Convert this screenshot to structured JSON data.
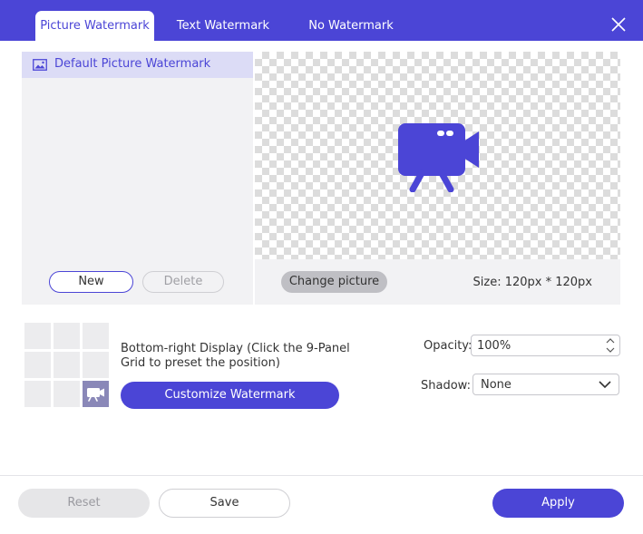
{
  "tabs": [
    {
      "label": "Picture Watermark",
      "active": true
    },
    {
      "label": "Text Watermark",
      "active": false
    },
    {
      "label": "No Watermark",
      "active": false
    }
  ],
  "colors": {
    "accent": "#4b45d6",
    "panel": "#f2f2f4",
    "selected_item": "#dcdcf6"
  },
  "watermark_list": {
    "items": [
      {
        "label": "Default Picture Watermark",
        "icon": "image-icon",
        "selected": true
      }
    ],
    "new_label": "New",
    "delete_label": "Delete"
  },
  "preview": {
    "icon": "video-camera-icon",
    "change_label": "Change picture",
    "size_text": "Size: 120px * 120px"
  },
  "position": {
    "grid_selected": "bottom-right",
    "text": "Bottom-right Display (Click the 9-Panel Grid to preset the position)",
    "customize_label": "Customize Watermark"
  },
  "opacity": {
    "label": "Opacity:",
    "value": "100%"
  },
  "shadow": {
    "label": "Shadow:",
    "value": "None"
  },
  "footer": {
    "reset_label": "Reset",
    "save_label": "Save",
    "apply_label": "Apply"
  }
}
